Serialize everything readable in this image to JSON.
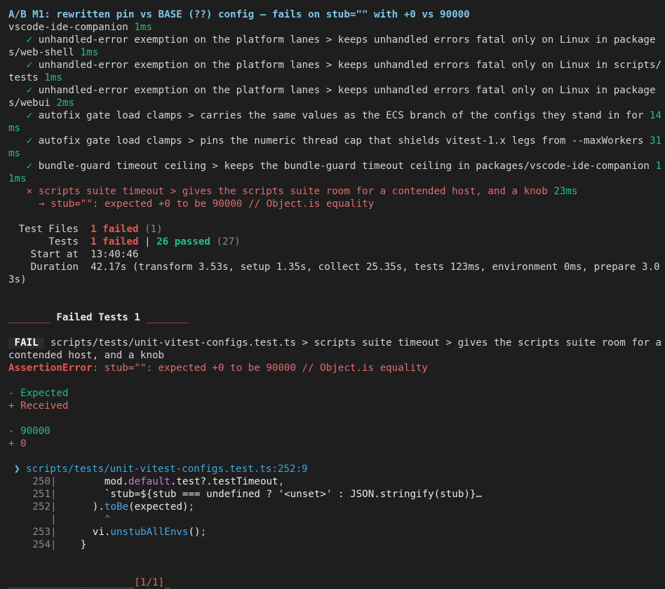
{
  "header": {
    "title": "A/B M1: rewritten pin vs BASE (??) config — fails on stub=\"\" with +0 vs 90000",
    "suite": "vscode-ide-companion",
    "suite_time": "1ms"
  },
  "results": [
    {
      "status": "pass",
      "mark": "✓",
      "text": "unhandled-error exemption on the platform lanes > keeps unhandled errors fatal only on Linux in packages/web-shell",
      "time": "1ms"
    },
    {
      "status": "pass",
      "mark": "✓",
      "text": "unhandled-error exemption on the platform lanes > keeps unhandled errors fatal only on Linux in scripts/tests",
      "time": "1ms"
    },
    {
      "status": "pass",
      "mark": "✓",
      "text": "unhandled-error exemption on the platform lanes > keeps unhandled errors fatal only on Linux in packages/webui",
      "time": "2ms"
    },
    {
      "status": "pass",
      "mark": "✓",
      "text": "autofix gate load clamps > carries the same values as the ECS branch of the configs they stand in for",
      "time": "14ms"
    },
    {
      "status": "pass",
      "mark": "✓",
      "text": "autofix gate load clamps > pins the numeric thread cap that shields vitest-1.x legs from --maxWorkers",
      "time": "31ms"
    },
    {
      "status": "pass",
      "mark": "✓",
      "text": "bundle-guard timeout ceiling > keeps the bundle-guard timeout ceiling in packages/vscode-ide-companion",
      "time": "11ms"
    },
    {
      "status": "fail",
      "mark": "×",
      "text": "scripts suite timeout > gives the scripts suite room for a contended host, and a knob",
      "time": "23ms"
    }
  ],
  "fail_detail": "→ stub=\"\": expected +0 to be 90000 // Object.is equality",
  "summary": {
    "test_files_label": "Test Files",
    "test_files_failed": "1 failed",
    "test_files_total": "(1)",
    "tests_label": "Tests",
    "tests_failed": "1 failed",
    "tests_sep": "|",
    "tests_passed": "26 passed",
    "tests_total": "(27)",
    "start_label": "Start at",
    "start_value": "13:40:46",
    "duration_label": "Duration",
    "duration_value": "42.17s (transform 3.53s, setup 1.35s, collect 25.35s, tests 123ms, environment 0ms, prepare 3.03s)"
  },
  "failed_section": {
    "rule_left": "_______",
    "title": "Failed Tests 1",
    "rule_right": "_______",
    "badge": "FAIL",
    "path": "scripts/tests/unit-vitest-configs.test.ts > scripts suite timeout > gives the scripts suite room for a contended host, and a knob",
    "error_name": "AssertionError",
    "error_msg": ": stub=\"\": expected +0 to be 90000 // Object.is equality",
    "expected_label": "- Expected",
    "received_label": "+ Received",
    "expected_value": "- 90000",
    "received_value": "+ 0",
    "location_arrow": "❯",
    "location": "scripts/tests/unit-vitest-configs.test.ts:252:9"
  },
  "code": [
    {
      "num": "250",
      "parts": [
        [
          "        mod.",
          "w"
        ],
        [
          "default",
          "m"
        ],
        [
          ".test?.testTimeout",
          ""
        ],
        [
          ",",
          "y"
        ]
      ]
    },
    {
      "num": "251",
      "parts": [
        [
          "        `stub=${stub === undefined ? '<unset>' : JSON.stringify(stub)}…",
          "w"
        ]
      ]
    },
    {
      "num": "252",
      "parts": [
        [
          "      ).",
          "w"
        ],
        [
          "toBe",
          "f"
        ],
        [
          "(expected)",
          "w"
        ],
        [
          ";",
          "y"
        ]
      ]
    },
    {
      "num": "",
      "parts": [
        [
          "        ^",
          "r"
        ]
      ]
    },
    {
      "num": "253",
      "parts": [
        [
          "      vi.",
          "w"
        ],
        [
          "unstubAllEnvs",
          "f"
        ],
        [
          "()",
          "w"
        ],
        [
          ";",
          "y"
        ]
      ]
    },
    {
      "num": "254",
      "parts": [
        [
          "    }",
          "w"
        ]
      ]
    }
  ],
  "footer": {
    "rule": "_____________________",
    "page": "[1/1]",
    "tail": "_"
  }
}
